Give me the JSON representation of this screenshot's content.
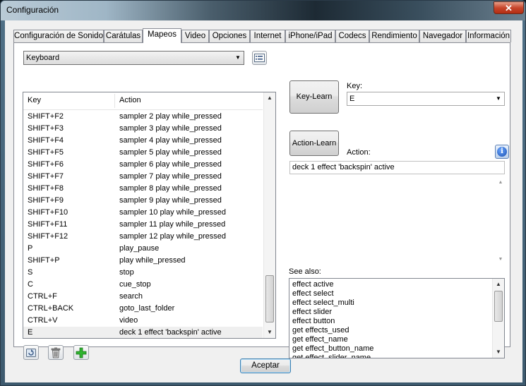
{
  "window": {
    "title": "Configuración",
    "close_glyph": "✕"
  },
  "tabs": [
    {
      "label": "Configuración de Sonido"
    },
    {
      "label": "Carátulas"
    },
    {
      "label": "Mapeos",
      "active": true
    },
    {
      "label": "Video"
    },
    {
      "label": "Opciones"
    },
    {
      "label": "Internet"
    },
    {
      "label": "iPhone/iPad"
    },
    {
      "label": "Codecs"
    },
    {
      "label": "Rendimiento"
    },
    {
      "label": "Navegador"
    },
    {
      "label": "Información"
    }
  ],
  "mapper": {
    "selected": "Keyboard"
  },
  "list": {
    "headers": {
      "key": "Key",
      "action": "Action"
    },
    "rows": [
      {
        "key": "SHIFT+F2",
        "action": "sampler 2 play while_pressed"
      },
      {
        "key": "SHIFT+F3",
        "action": "sampler 3 play while_pressed"
      },
      {
        "key": "SHIFT+F4",
        "action": "sampler 4 play while_pressed"
      },
      {
        "key": "SHIFT+F5",
        "action": "sampler 5 play while_pressed"
      },
      {
        "key": "SHIFT+F6",
        "action": "sampler 6 play while_pressed"
      },
      {
        "key": "SHIFT+F7",
        "action": "sampler 7 play while_pressed"
      },
      {
        "key": "SHIFT+F8",
        "action": "sampler 8 play while_pressed"
      },
      {
        "key": "SHIFT+F9",
        "action": "sampler 9 play while_pressed"
      },
      {
        "key": "SHIFT+F10",
        "action": "sampler 10 play while_pressed"
      },
      {
        "key": "SHIFT+F11",
        "action": "sampler 11 play while_pressed"
      },
      {
        "key": "SHIFT+F12",
        "action": "sampler 12 play while_pressed"
      },
      {
        "key": "P",
        "action": "play_pause"
      },
      {
        "key": "SHIFT+P",
        "action": "play while_pressed"
      },
      {
        "key": "S",
        "action": "stop"
      },
      {
        "key": "C",
        "action": "cue_stop"
      },
      {
        "key": "CTRL+F",
        "action": "search"
      },
      {
        "key": "CTRL+BACK",
        "action": "goto_last_folder"
      },
      {
        "key": "CTRL+V",
        "action": "video"
      },
      {
        "key": "E",
        "action": "deck 1 effect 'backspin' active",
        "selected": true
      }
    ]
  },
  "right": {
    "key_learn_label": "Key-Learn",
    "key_label": "Key:",
    "key_value": "E",
    "action_learn_label": "Action-Learn",
    "action_label": "Action:",
    "action_value": "deck 1 effect 'backspin' active",
    "info_glyph": "i",
    "see_also_label": "See also:",
    "see_also": [
      "effect active",
      "effect select",
      "effect select_multi",
      "effect slider",
      "effect button",
      "get effects_used",
      "get effect_name",
      "get effect_button_name",
      "get effect_slider_name"
    ]
  },
  "footer": {
    "accept_label": "Aceptar"
  }
}
